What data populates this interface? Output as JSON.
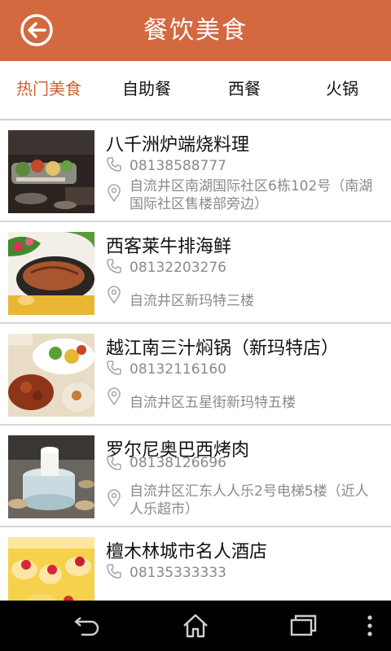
{
  "header": {
    "title": "餐饮美食"
  },
  "tabs": [
    {
      "label": "热门美食"
    },
    {
      "label": "自助餐"
    },
    {
      "label": "西餐"
    },
    {
      "label": "火锅"
    }
  ],
  "restaurants": [
    {
      "name": "八千洲炉端烧料理",
      "phone": "08138588777",
      "address": "自流井区南湖国际社区6栋102号（南湖国际社区售楼部旁边）"
    },
    {
      "name": "西客莱牛排海鲜",
      "phone": "08132203276",
      "address": "自流井区新玛特三楼"
    },
    {
      "name": "越江南三汁焖锅（新玛特店）",
      "phone": "08132116160",
      "address": "自流井区五星街新玛特五楼"
    },
    {
      "name": "罗尔尼奥巴西烤肉",
      "phone": "08138126696",
      "address": "自流井区汇东人人乐2号电梯5楼（近人人乐超市）"
    },
    {
      "name": "檀木林城市名人酒店",
      "phone": "08135333333",
      "address": ""
    }
  ],
  "colors": {
    "header_bg": "#d4683f",
    "tab_active": "#cf6234",
    "text_secondary": "#8a8a8a"
  }
}
